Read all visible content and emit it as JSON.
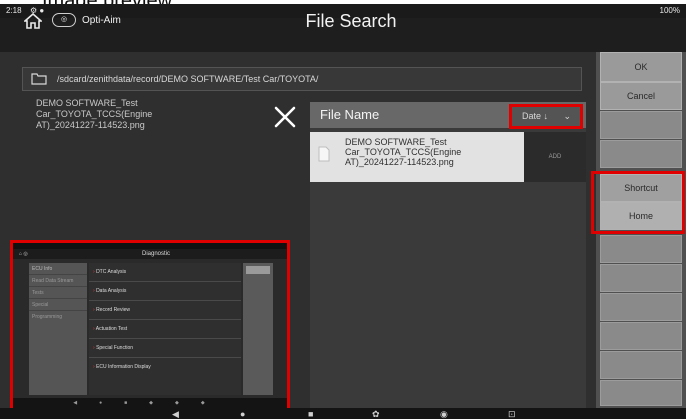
{
  "caption": "Image preview",
  "status": {
    "time": "2:18",
    "icons": [
      "gear-status-icon",
      "circle-status-icon"
    ],
    "battery": "100%"
  },
  "header": {
    "brand": "Opti-Aim",
    "title": "File Search",
    "home_icon": "home-icon"
  },
  "path": "/sdcard/zenithdata/record/DEMO SOFTWARE/Test Car/TOYOTA/",
  "selected_file": "DEMO SOFTWARE_Test Car_TOYOTA_TCCS(Engine AT)_20241227-114523.png",
  "file_list": {
    "header": "File Name",
    "sort": "Date",
    "items": [
      {
        "name": "DEMO SOFTWARE_Test Car_TOYOTA_TCCS(Engine AT)_20241227-114523.png",
        "action": "ADD"
      }
    ]
  },
  "side_buttons": {
    "ok": "OK",
    "cancel": "Cancel",
    "shortcut": "Shortcut",
    "home": "Home"
  },
  "preview": {
    "title": "Diagnostic",
    "left_items": [
      "ECU Info",
      "Read Data Stream",
      "Tests",
      "Special",
      "Programming",
      ""
    ],
    "menu": [
      "DTC Analysis",
      "Data Analysis",
      "Record Review",
      "Actuation Test",
      "Special Function",
      "ECU Information Display"
    ]
  },
  "colors": {
    "highlight": "#e00000",
    "panel": "#3a3a3a",
    "header": "#686868"
  }
}
